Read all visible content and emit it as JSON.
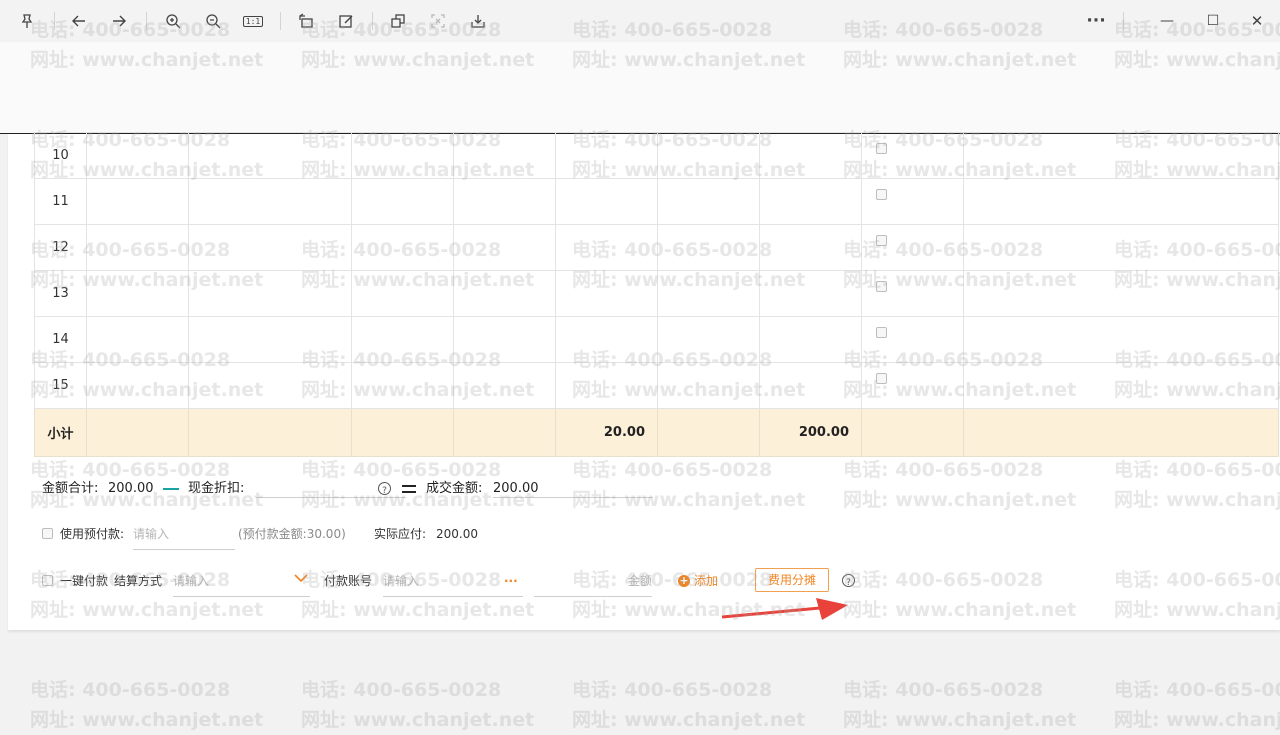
{
  "toolbar": {
    "pin_icon": "pin-icon",
    "back_icon": "arrow-left-icon",
    "forward_icon": "arrow-right-icon",
    "zoom_in_icon": "zoom-in-icon",
    "zoom_out_icon": "zoom-out-icon",
    "actual_size_label": "1:1",
    "more_label": "···",
    "minimize_label": "—",
    "maximize_label": "☐",
    "close_label": "✕"
  },
  "table": {
    "rows": [
      {
        "num": "10"
      },
      {
        "num": "11"
      },
      {
        "num": "12"
      },
      {
        "num": "13"
      },
      {
        "num": "14"
      },
      {
        "num": "15"
      }
    ],
    "subtotal": {
      "label": "小计",
      "quantity": "20.00",
      "amount": "200.00"
    }
  },
  "summary": {
    "total_label": "金额合计:",
    "total_value": "200.00",
    "discount_label": "现金折扣:",
    "deal_label": "成交金额:",
    "deal_value": "200.00",
    "help": "?"
  },
  "prepay": {
    "use_label": "使用预付款:",
    "placeholder": "请输入",
    "balance_text": "(预付款金额:30.00)",
    "payable_label": "实际应付:",
    "payable_value": "200.00"
  },
  "payment": {
    "one_click_label": "一键付款",
    "method_label": "结算方式",
    "method_placeholder": "请输入",
    "account_label": "付款账号",
    "account_placeholder": "请输入",
    "ellipsis": "···",
    "amount_placeholder": "金额",
    "add_label": "添加",
    "fee_button": "费用分摊",
    "help": "?"
  },
  "watermark": {
    "phone": "电话: 400-665-0028",
    "site": "网址: www.chanjet.net"
  },
  "colors": {
    "accent": "#f0831e",
    "teal": "#19a3a3",
    "subtotal_bg": "#fdf0d9",
    "arrow": "#e8423a"
  }
}
